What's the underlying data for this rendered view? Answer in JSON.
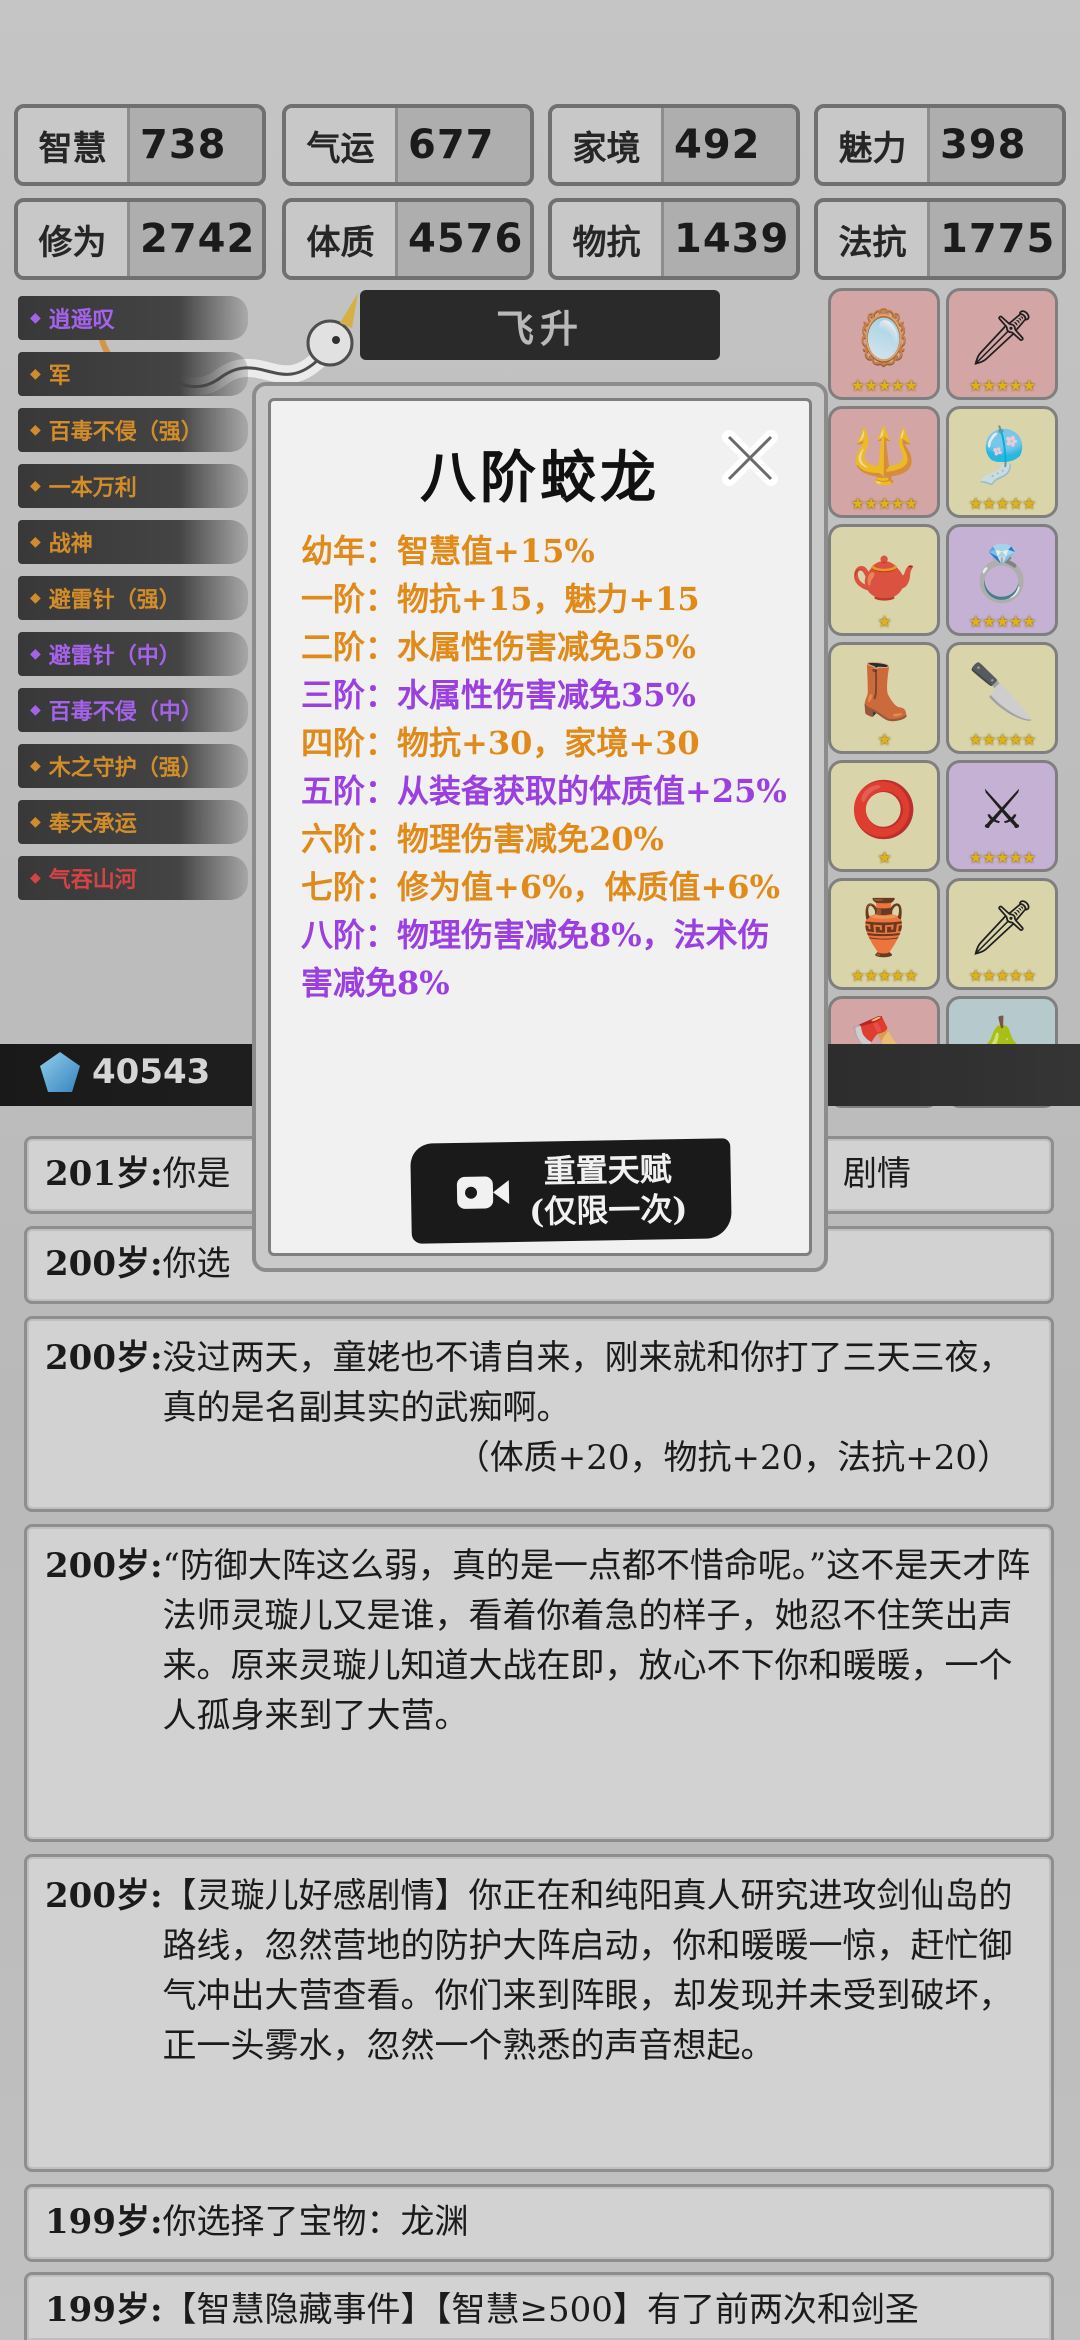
{
  "stats": [
    {
      "label": "智慧",
      "value": "738"
    },
    {
      "label": "气运",
      "value": "677"
    },
    {
      "label": "家境",
      "value": "492"
    },
    {
      "label": "魅力",
      "value": "398"
    },
    {
      "label": "修为",
      "value": "2742"
    },
    {
      "label": "体质",
      "value": "4576"
    },
    {
      "label": "物抗",
      "value": "1439"
    },
    {
      "label": "法抗",
      "value": "1775"
    }
  ],
  "banner": {
    "label": "飞升"
  },
  "talents": [
    {
      "label": "逍遥叹",
      "color": "#b46bff"
    },
    {
      "label": "军",
      "color": "#e49a2e"
    },
    {
      "label": "百毒不侵（强）",
      "color": "#e49a2e"
    },
    {
      "label": "一本万利",
      "color": "#e49a2e"
    },
    {
      "label": "战神",
      "color": "#e49a2e"
    },
    {
      "label": "避雷针（强）",
      "color": "#e49a2e"
    },
    {
      "label": "避雷针（中）",
      "color": "#b46bff"
    },
    {
      "label": "百毒不侵（中）",
      "color": "#b46bff"
    },
    {
      "label": "木之守护（强）",
      "color": "#e49a2e"
    },
    {
      "label": "奉天承运",
      "color": "#e49a2e"
    },
    {
      "label": "气吞山河",
      "color": "#e84a4a"
    }
  ],
  "equipment": [
    {
      "name": "mirror",
      "bg": "#e7b4b4",
      "stars": 5
    },
    {
      "name": "sword",
      "bg": "#e7b4b4",
      "stars": 5
    },
    {
      "name": "spear",
      "bg": "#e7b4b4",
      "stars": 5
    },
    {
      "name": "pendant",
      "bg": "#ece6b8",
      "stars": 5
    },
    {
      "name": "teapot",
      "bg": "#ece6b8",
      "stars": 1
    },
    {
      "name": "ring",
      "bg": "#d6c0e6",
      "stars": 5
    },
    {
      "name": "boots",
      "bg": "#ece6b8",
      "stars": 1
    },
    {
      "name": "blade",
      "bg": "#ece6b8",
      "stars": 5
    },
    {
      "name": "gold-ring",
      "bg": "#ece6b8",
      "stars": 1
    },
    {
      "name": "red-sword",
      "bg": "#d6c0e6",
      "stars": 5
    },
    {
      "name": "cauldron",
      "bg": "#ece6b8",
      "stars": 5
    },
    {
      "name": "jade-sword",
      "bg": "#ece6b8",
      "stars": 5
    },
    {
      "name": "axe",
      "bg": "#e7b4b4",
      "stars": 5
    },
    {
      "name": "gourd",
      "bg": "#c6dcdf",
      "stars": 1
    }
  ],
  "currency": {
    "gems": "40543"
  },
  "modal": {
    "title": "八阶蛟龙",
    "tiers": [
      {
        "text": "幼年：智慧值+15%",
        "color": "orange"
      },
      {
        "text": "一阶：物抗+15，魅力+15",
        "color": "orange"
      },
      {
        "text": "二阶：水属性伤害减免55%",
        "color": "orange"
      },
      {
        "text": "三阶：水属性伤害减免35%",
        "color": "purple"
      },
      {
        "text": "四阶：物抗+30，家境+30",
        "color": "orange"
      },
      {
        "text": "五阶：从装备获取的体质值+25%",
        "color": "purple"
      },
      {
        "text": "六阶：物理伤害减免20%",
        "color": "orange"
      },
      {
        "text": "七阶：修为值+6%，体质值+6%",
        "color": "orange"
      },
      {
        "text": "八阶：物理伤害减免8%，法术伤害减免8%",
        "color": "purple"
      }
    ],
    "button_line1": "重置天赋",
    "button_line2": "(仅限一次)"
  },
  "logs": [
    {
      "age": "201岁:",
      "text": "你是",
      "tail": "剧情"
    },
    {
      "age": "200岁:",
      "text": "你选"
    },
    {
      "age": "200岁:",
      "text": "没过两天，童姥也不请自来，刚来就和你打了三天三夜，真的是名副其实的武痴啊。",
      "sub": "（体质+20，物抗+20，法抗+20）"
    },
    {
      "age": "200岁:",
      "text": "“防御大阵这么弱，真的是一点都不惜命呢。”这不是天才阵法师灵璇儿又是谁，看着你着急的样子，她忍不住笑出声来。原来灵璇儿知道大战在即，放心不下你和暖暖，一个人孤身来到了大营。"
    },
    {
      "age": "200岁:",
      "text": "【灵璇儿好感剧情】你正在和纯阳真人研究进攻剑仙岛的路线，忽然营地的防护大阵启动，你和暖暖一惊，赶忙御气冲出大营查看。你们来到阵眼，却发现并未受到破坏，正一头雾水，忽然一个熟悉的声音想起。"
    },
    {
      "age": "199岁:",
      "text": "你选择了宝物：龙渊"
    },
    {
      "age": "199岁:",
      "text": "【智慧隐藏事件】【智慧≥500】有了前两次和剑圣"
    }
  ]
}
